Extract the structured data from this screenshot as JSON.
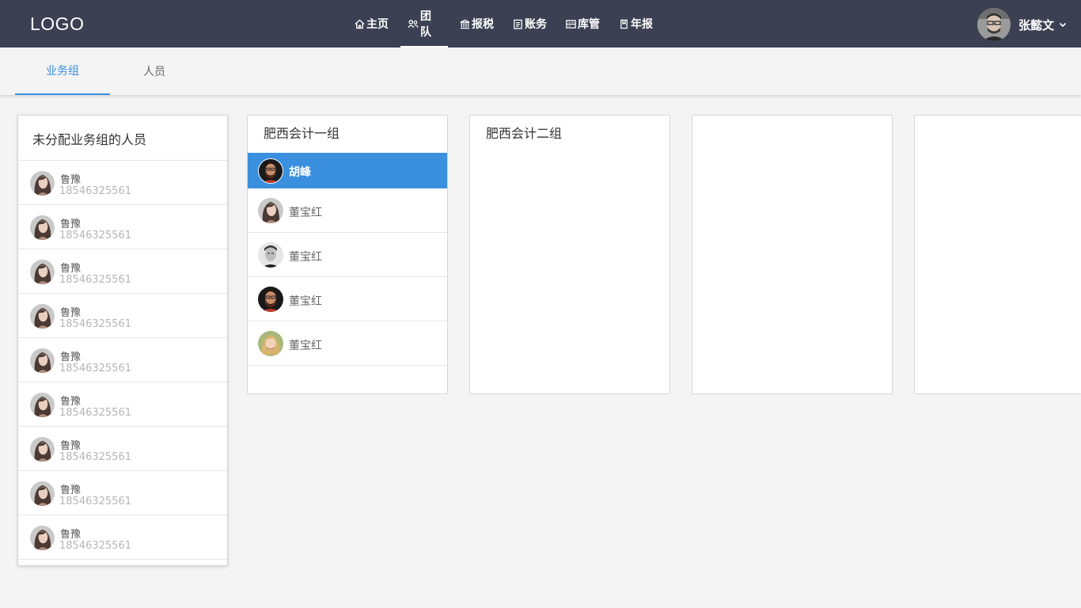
{
  "header": {
    "logo": "LOGO",
    "nav": [
      {
        "label": "主页",
        "icon": "home-icon"
      },
      {
        "label": "团队",
        "icon": "team-icon",
        "active": true
      },
      {
        "label": "报税",
        "icon": "tax-icon"
      },
      {
        "label": "账务",
        "icon": "ledger-icon"
      },
      {
        "label": "库管",
        "icon": "inventory-icon"
      },
      {
        "label": "年报",
        "icon": "annual-report-icon"
      }
    ],
    "user": {
      "name": "张懿文",
      "avatar": "user-avatar",
      "dropdown_icon": "chevron-down-icon"
    }
  },
  "tabs": [
    {
      "label": "业务组",
      "active": true
    },
    {
      "label": "人员",
      "active": false
    }
  ],
  "unassigned": {
    "title": "未分配业务组的人员",
    "people": [
      {
        "name": "鲁豫",
        "phone": "18546325561"
      },
      {
        "name": "鲁豫",
        "phone": "18546325561"
      },
      {
        "name": "鲁豫",
        "phone": "18546325561"
      },
      {
        "name": "鲁豫",
        "phone": "18546325561"
      },
      {
        "name": "鲁豫",
        "phone": "18546325561"
      },
      {
        "name": "鲁豫",
        "phone": "18546325561"
      },
      {
        "name": "鲁豫",
        "phone": "18546325561"
      },
      {
        "name": "鲁豫",
        "phone": "18546325561"
      },
      {
        "name": "鲁豫",
        "phone": "18546325561"
      }
    ]
  },
  "groups": [
    {
      "title": "肥西会计一组",
      "members": [
        {
          "name": "胡峰",
          "selected": true
        },
        {
          "name": "董宝红"
        },
        {
          "name": "董宝红"
        },
        {
          "name": "董宝红"
        },
        {
          "name": "董宝红"
        }
      ]
    },
    {
      "title": "肥西会计二组",
      "members": []
    },
    {
      "title": "",
      "members": []
    },
    {
      "title": "",
      "members": []
    }
  ],
  "colors": {
    "nav_bg": "#3b4052",
    "accent": "#3a8ee0",
    "selected_row": "#3a90de",
    "page_bg": "#f4f4f4"
  }
}
